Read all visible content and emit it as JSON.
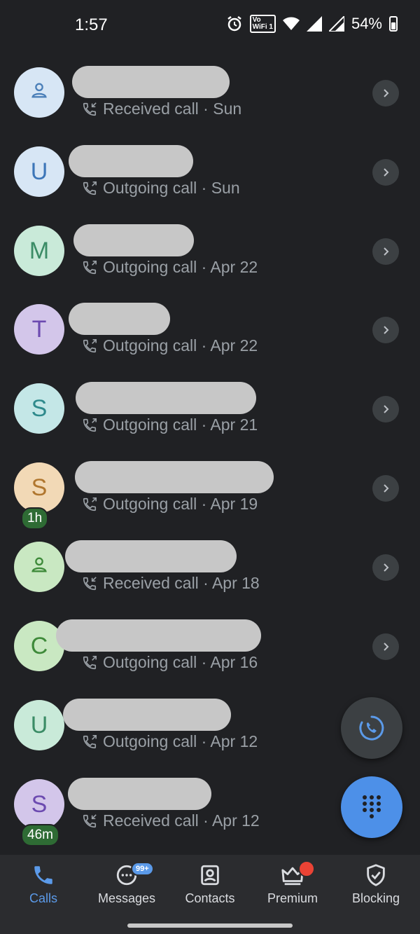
{
  "status_bar": {
    "time": "1:57",
    "vowifi_top": "Vo",
    "vowifi_bottom": "WiFi 1",
    "battery": "54%"
  },
  "calls": [
    {
      "initial": "",
      "avatar_icon": "person-icon",
      "avatar_bg": "#d7e6f5",
      "avatar_fg": "#4b7fb8",
      "call_type": "received",
      "label": "Received call · Sun",
      "badge": ""
    },
    {
      "initial": "U",
      "avatar_icon": "",
      "avatar_bg": "#d7e6f5",
      "avatar_fg": "#3d76b8",
      "call_type": "outgoing",
      "label": "Outgoing call · Sun",
      "badge": ""
    },
    {
      "initial": "M",
      "avatar_icon": "",
      "avatar_bg": "#c9ead9",
      "avatar_fg": "#3b8c66",
      "call_type": "outgoing",
      "label": "Outgoing call · Apr 22",
      "badge": ""
    },
    {
      "initial": "T",
      "avatar_icon": "",
      "avatar_bg": "#d3c6ea",
      "avatar_fg": "#6c4ab0",
      "call_type": "outgoing",
      "label": "Outgoing call · Apr 22",
      "badge": ""
    },
    {
      "initial": "S",
      "avatar_icon": "",
      "avatar_bg": "#c4e7e7",
      "avatar_fg": "#2f8a8c",
      "call_type": "outgoing",
      "label": "Outgoing call · Apr 21",
      "badge": ""
    },
    {
      "initial": "S",
      "avatar_icon": "",
      "avatar_bg": "#f2d9b6",
      "avatar_fg": "#b0762e",
      "call_type": "outgoing",
      "label": "Outgoing call · Apr 19",
      "badge": "1h"
    },
    {
      "initial": "",
      "avatar_icon": "person-icon",
      "avatar_bg": "#c9e8c2",
      "avatar_fg": "#3e8a3a",
      "call_type": "received",
      "label": "Received call · Apr 18",
      "badge": ""
    },
    {
      "initial": "C",
      "avatar_icon": "",
      "avatar_bg": "#c9e8c2",
      "avatar_fg": "#3e8a3a",
      "call_type": "outgoing",
      "label": "Outgoing call · Apr 16",
      "badge": ""
    },
    {
      "initial": "U",
      "avatar_icon": "",
      "avatar_bg": "#c9ead9",
      "avatar_fg": "#3b8c66",
      "call_type": "outgoing",
      "label": "Outgoing call · Apr 12",
      "badge": ""
    },
    {
      "initial": "S",
      "avatar_icon": "",
      "avatar_bg": "#d3c6ea",
      "avatar_fg": "#6c4ab0",
      "call_type": "received",
      "label": "Received call · Apr 12",
      "badge": "46m"
    }
  ],
  "bottom_nav": [
    {
      "label": "Calls",
      "icon": "phone-icon",
      "active": true,
      "badge": ""
    },
    {
      "label": "Messages",
      "icon": "chat-bubble-icon",
      "active": false,
      "badge": "99+"
    },
    {
      "label": "Contacts",
      "icon": "contact-card-icon",
      "active": false,
      "badge": ""
    },
    {
      "label": "Premium",
      "icon": "crown-icon",
      "active": false,
      "badge": "dot"
    },
    {
      "label": "Blocking",
      "icon": "shield-check-icon",
      "active": false,
      "badge": ""
    }
  ],
  "colors": {
    "background": "#202124",
    "accent": "#5b9ae9",
    "redacted": "#c7c7c7"
  }
}
